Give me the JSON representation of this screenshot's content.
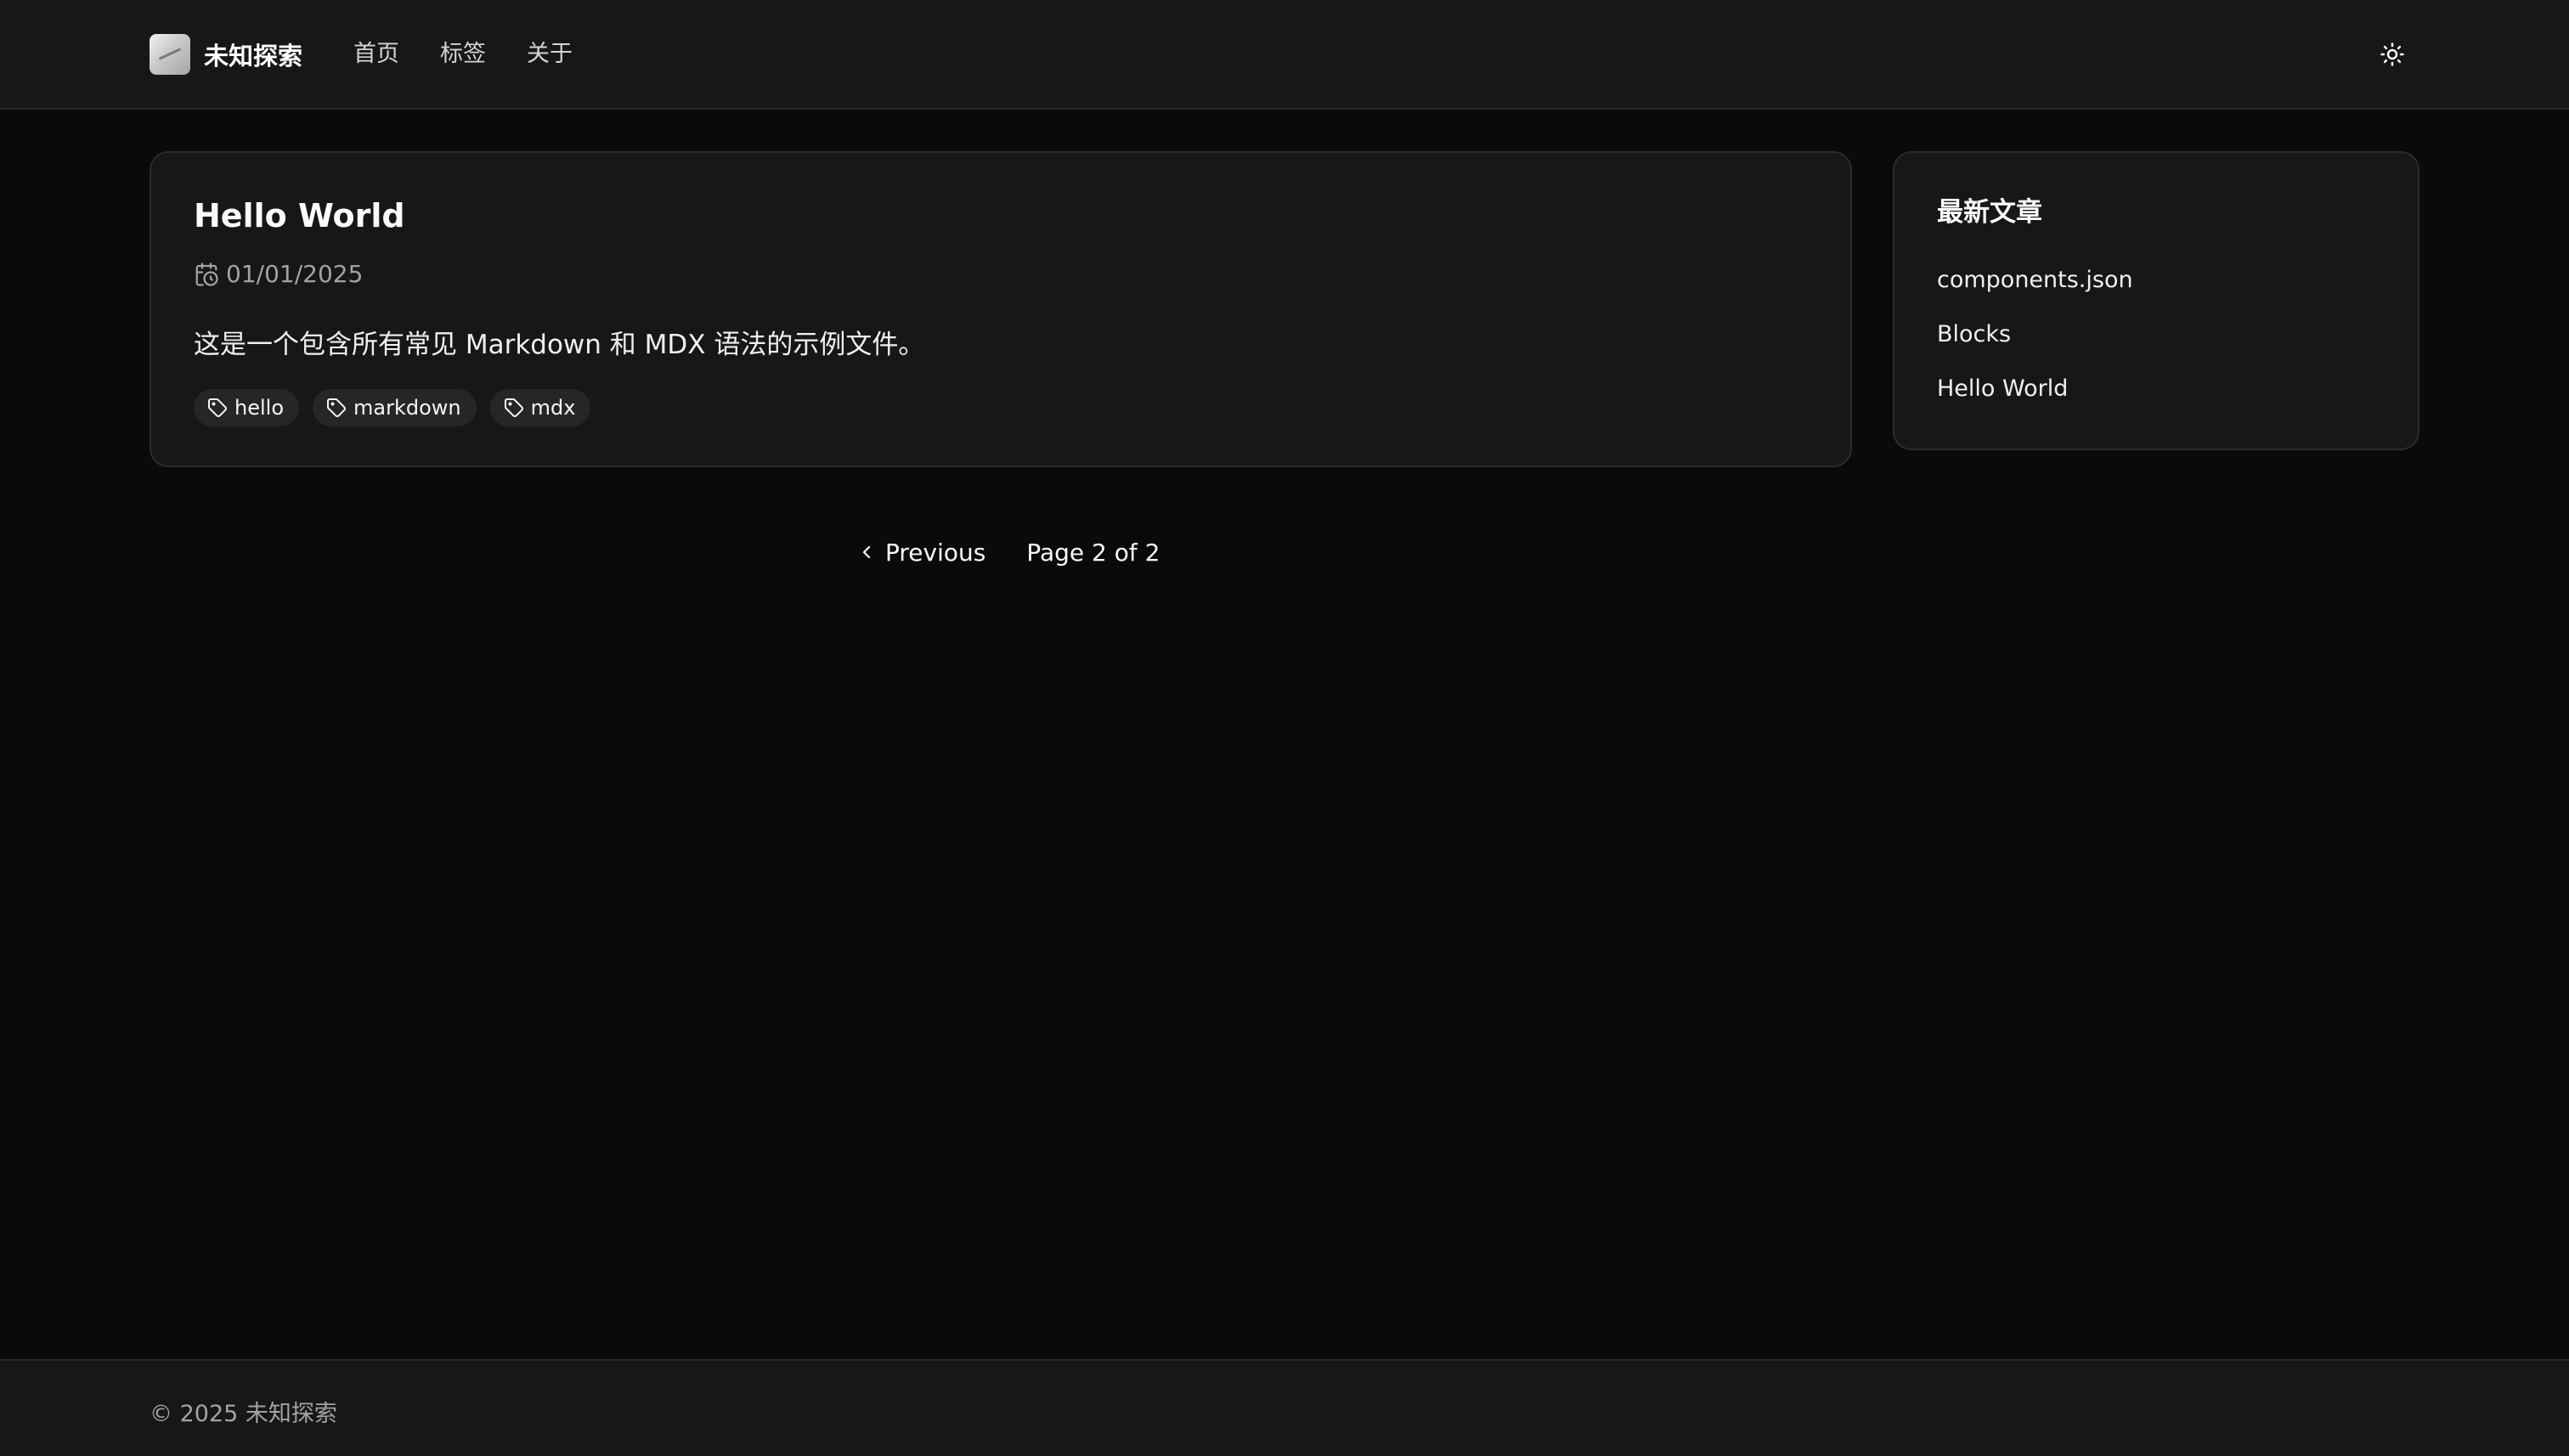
{
  "header": {
    "site_name": "未知探索",
    "nav": [
      "首页",
      "标签",
      "关于"
    ],
    "theme_toggle_icon": "sun-icon"
  },
  "post": {
    "title": "Hello World",
    "date": "01/01/2025",
    "excerpt": "这是一个包含所有常见 Markdown 和 MDX 语法的示例文件。",
    "tags": [
      "hello",
      "markdown",
      "mdx"
    ]
  },
  "sidebar": {
    "title": "最新文章",
    "items": [
      "components.json",
      "Blocks",
      "Hello World"
    ]
  },
  "pagination": {
    "previous_label": "Previous",
    "page_info": "Page 2 of 2"
  },
  "footer": {
    "copyright": "© 2025 未知探索"
  },
  "colors": {
    "background": "#0a0a0a",
    "surface": "#171717",
    "border": "#2c2c2c",
    "muted_text": "#a3a3a3",
    "tag_background": "#262626"
  }
}
